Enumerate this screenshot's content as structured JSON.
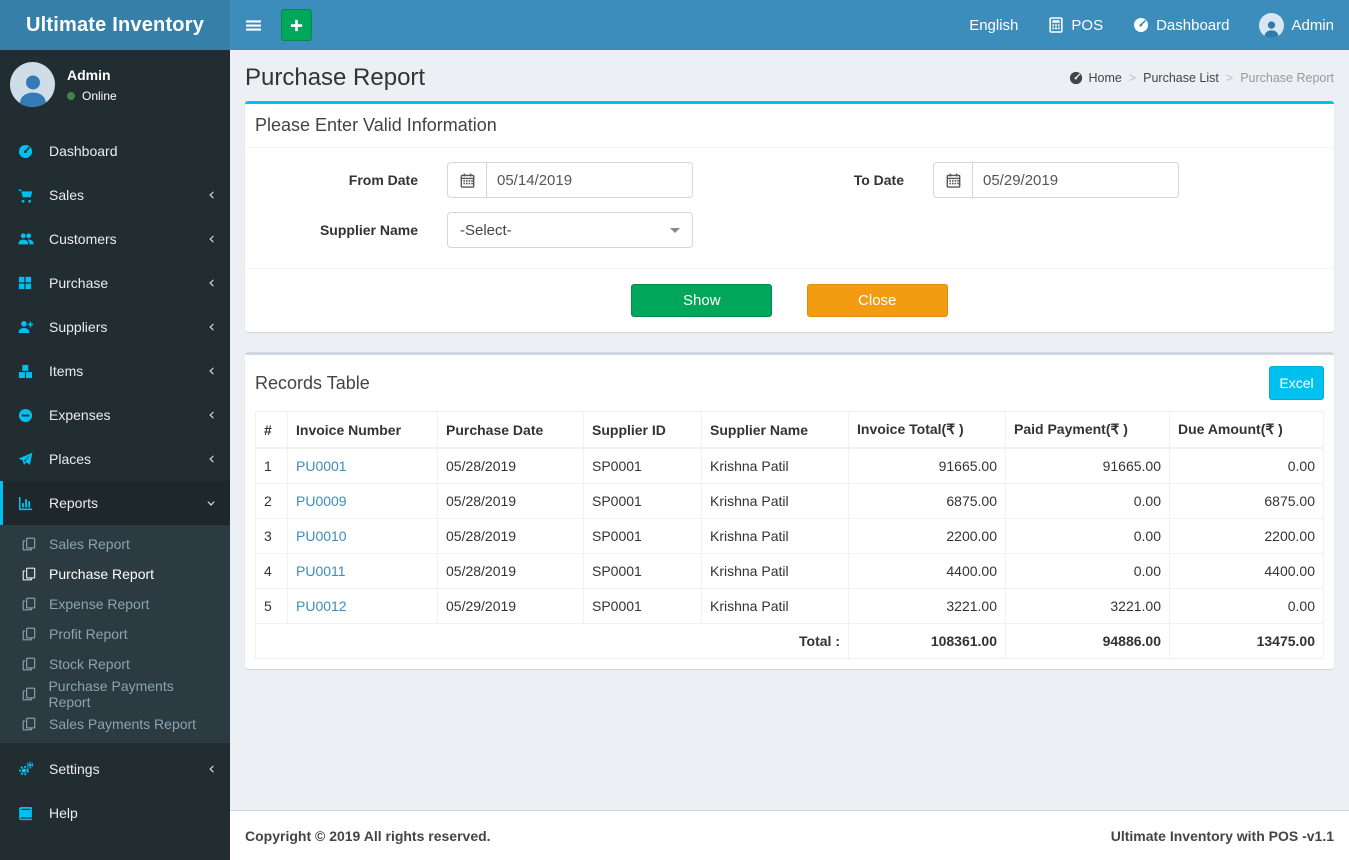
{
  "app": {
    "title": "Ultimate Inventory"
  },
  "colors": {
    "navbar": "#3c8dbc",
    "logo": "#367fa9",
    "sidebar": "#222d32",
    "accent_cyan": "#00c0ef",
    "green": "#00a65a",
    "orange": "#f39c12",
    "link": "#3c8dbc"
  },
  "topbar": {
    "nav": [
      {
        "label": "English"
      },
      {
        "label": "POS"
      },
      {
        "label": "Dashboard"
      },
      {
        "label": "Admin"
      }
    ]
  },
  "sidebar": {
    "user": {
      "name": "Admin",
      "status": "Online"
    },
    "menu": [
      {
        "label": "Dashboard"
      },
      {
        "label": "Sales"
      },
      {
        "label": "Customers"
      },
      {
        "label": "Purchase"
      },
      {
        "label": "Suppliers"
      },
      {
        "label": "Items"
      },
      {
        "label": "Expenses"
      },
      {
        "label": "Places"
      },
      {
        "label": "Reports"
      },
      {
        "label": "Settings"
      },
      {
        "label": "Help"
      }
    ],
    "reports_submenu": [
      {
        "label": "Sales Report"
      },
      {
        "label": "Purchase Report"
      },
      {
        "label": "Expense Report"
      },
      {
        "label": "Profit Report"
      },
      {
        "label": "Stock Report"
      },
      {
        "label": "Purchase Payments Report"
      },
      {
        "label": "Sales Payments Report"
      }
    ]
  },
  "page": {
    "title": "Purchase Report",
    "breadcrumb": {
      "items": [
        "Home",
        "Purchase List",
        "Purchase Report"
      ]
    }
  },
  "filter_form": {
    "title": "Please Enter Valid Information",
    "from_date_label": "From Date",
    "from_date_value": "05/14/2019",
    "to_date_label": "To Date",
    "to_date_value": "05/29/2019",
    "supplier_label": "Supplier Name",
    "supplier_value": "-Select-",
    "show_button": "Show",
    "close_button": "Close"
  },
  "records": {
    "title": "Records Table",
    "excel_button": "Excel",
    "columns": [
      "#",
      "Invoice Number",
      "Purchase Date",
      "Supplier ID",
      "Supplier Name",
      "Invoice Total(₹ )",
      "Paid Payment(₹ )",
      "Due Amount(₹ )"
    ],
    "rows": [
      {
        "num": "1",
        "invoice": "PU0001",
        "date": "05/28/2019",
        "supplier_id": "SP0001",
        "supplier_name": "Krishna Patil",
        "total": "91665.00",
        "paid": "91665.00",
        "due": "0.00"
      },
      {
        "num": "2",
        "invoice": "PU0009",
        "date": "05/28/2019",
        "supplier_id": "SP0001",
        "supplier_name": "Krishna Patil",
        "total": "6875.00",
        "paid": "0.00",
        "due": "6875.00"
      },
      {
        "num": "3",
        "invoice": "PU0010",
        "date": "05/28/2019",
        "supplier_id": "SP0001",
        "supplier_name": "Krishna Patil",
        "total": "2200.00",
        "paid": "0.00",
        "due": "2200.00"
      },
      {
        "num": "4",
        "invoice": "PU0011",
        "date": "05/28/2019",
        "supplier_id": "SP0001",
        "supplier_name": "Krishna Patil",
        "total": "4400.00",
        "paid": "0.00",
        "due": "4400.00"
      },
      {
        "num": "5",
        "invoice": "PU0012",
        "date": "05/29/2019",
        "supplier_id": "SP0001",
        "supplier_name": "Krishna Patil",
        "total": "3221.00",
        "paid": "3221.00",
        "due": "0.00"
      }
    ],
    "total_label": "Total :",
    "totals": [
      "108361.00",
      "94886.00",
      "13475.00"
    ]
  },
  "footer": {
    "copyright": "Copyright © 2019 All rights reserved.",
    "version": "Ultimate Inventory with POS -v1.1"
  }
}
